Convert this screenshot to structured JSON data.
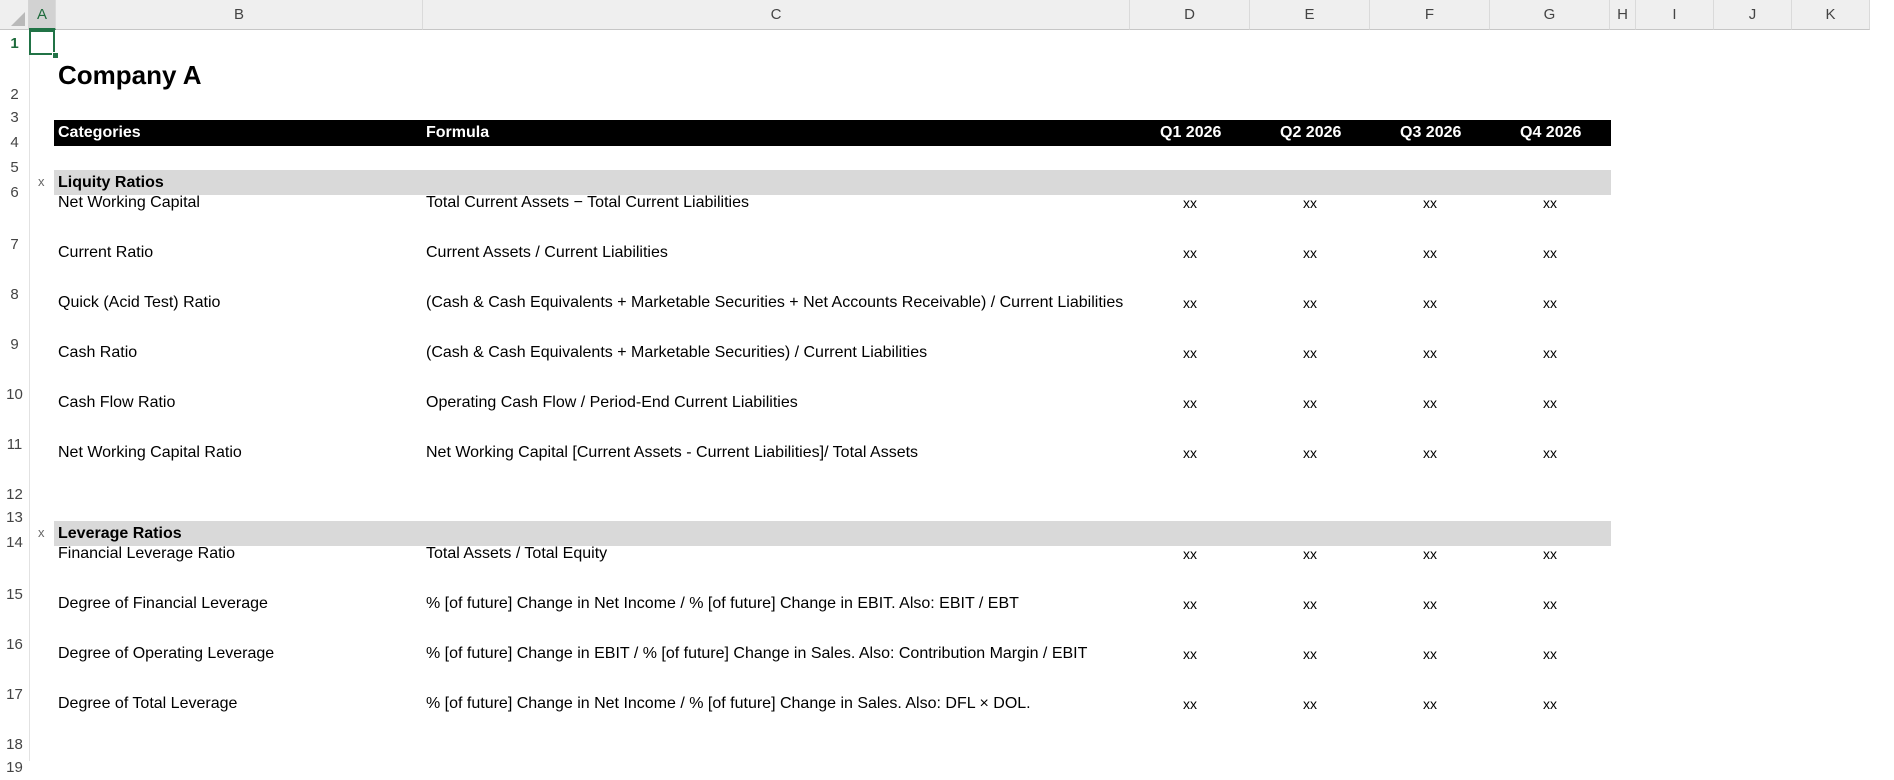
{
  "columns": [
    "A",
    "B",
    "C",
    "D",
    "E",
    "F",
    "G",
    "H",
    "I",
    "J",
    "K"
  ],
  "rows": [
    "1",
    "2",
    "3",
    "4",
    "5",
    "6",
    "7",
    "8",
    "9",
    "10",
    "11",
    "12",
    "13",
    "14",
    "15",
    "16",
    "17",
    "18",
    "19"
  ],
  "title": "Company A",
  "header": {
    "categories": "Categories",
    "formula": "Formula",
    "quarters": [
      "Q1 2026",
      "Q2 2026",
      "Q3 2026",
      "Q4 2026"
    ]
  },
  "sections": [
    {
      "marker": "x",
      "name": "Liquity Ratios",
      "items": [
        {
          "category": "Net Working Capital",
          "formula": "Total Current Assets − Total Current Liabilities",
          "values": [
            "xx",
            "xx",
            "xx",
            "xx"
          ]
        },
        {
          "category": "Current Ratio",
          "formula": "Current Assets / Current Liabilities",
          "values": [
            "xx",
            "xx",
            "xx",
            "xx"
          ]
        },
        {
          "category": "Quick (Acid Test) Ratio",
          "formula": "(Cash & Cash Equivalents + Marketable Securities + Net Accounts Receivable) / Current Liabilities",
          "values": [
            "xx",
            "xx",
            "xx",
            "xx"
          ]
        },
        {
          "category": "Cash Ratio",
          "formula": "(Cash & Cash Equivalents + Marketable Securities) / Current Liabilities",
          "values": [
            "xx",
            "xx",
            "xx",
            "xx"
          ]
        },
        {
          "category": "Cash Flow Ratio",
          "formula": "Operating Cash Flow / Period-End Current Liabilities",
          "values": [
            "xx",
            "xx",
            "xx",
            "xx"
          ]
        },
        {
          "category": "Net Working Capital Ratio",
          "formula": "Net Working Capital [Current Assets - Current Liabilities]/ Total Assets",
          "values": [
            "xx",
            "xx",
            "xx",
            "xx"
          ]
        }
      ]
    },
    {
      "marker": "x",
      "name": "Leverage Ratios",
      "items": [
        {
          "category": "Financial Leverage Ratio",
          "formula": "Total Assets / Total Equity",
          "values": [
            "xx",
            "xx",
            "xx",
            "xx"
          ]
        },
        {
          "category": "Degree of Financial Leverage",
          "formula": "% [of future] Change in Net Income / % [of future] Change in EBIT. Also: EBIT / EBT",
          "values": [
            "xx",
            "xx",
            "xx",
            "xx"
          ]
        },
        {
          "category": "Degree of Operating Leverage",
          "formula": "% [of future] Change in EBIT / % [of future] Change in Sales. Also: Contribution Margin / EBIT",
          "values": [
            "xx",
            "xx",
            "xx",
            "xx"
          ]
        },
        {
          "category": "Degree of Total Leverage",
          "formula": "% [of future] Change in Net Income / % [of future] Change in Sales. Also: DFL × DOL.",
          "values": [
            "xx",
            "xx",
            "xx",
            "xx"
          ]
        }
      ]
    }
  ]
}
